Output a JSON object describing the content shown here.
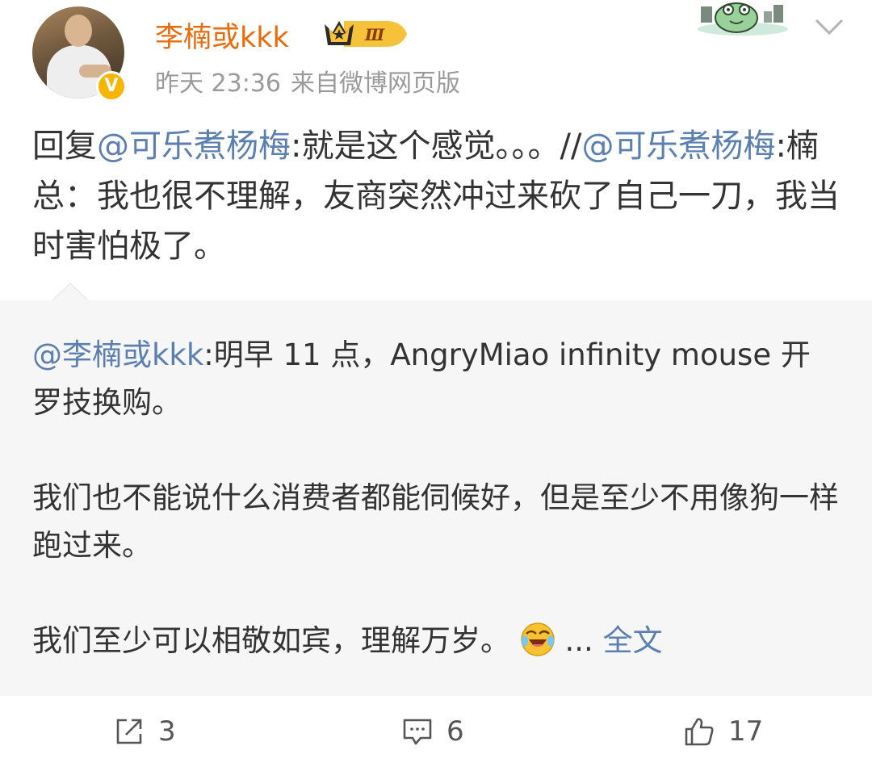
{
  "header": {
    "username": "李楠或kkk",
    "vip_level": "Ⅲ",
    "verified_mark": "V",
    "time": "昨天 23:36",
    "source": "来自微博网页版"
  },
  "post": {
    "prefix": "回复",
    "mention": "@可乐煮杨梅",
    "text": ":就是这个感觉。。。//",
    "quoted_mention": "@可乐煮杨梅",
    "quoted_text": ":楠总：我也很不理解，友商突然冲过来砍了自己一刀，我当时害怕极了。"
  },
  "repost": {
    "mention": "@李楠或kkk",
    "paragraph1": ":明早 11 点，AngryMiao infinity mouse 开罗技换购。",
    "paragraph2": "我们也不能说什么消费者都能伺候好，但是至少不用像狗一样跑过来。",
    "paragraph3": "我们至少可以相敬如宾，理解万岁。",
    "ellipsis": " ... ",
    "full_text_link": "全文"
  },
  "actions": {
    "share_count": "3",
    "comment_count": "6",
    "like_count": "17"
  },
  "icons": [
    "share-icon",
    "comment-icon",
    "like-icon",
    "laugh-cry-emoji-icon",
    "chevron-down-icon",
    "crown-vip-icon",
    "frog-card-decoration"
  ],
  "colors": {
    "username": "#e86b0c",
    "link": "#5b80b0",
    "meta": "#9a9a9a",
    "repost_bg": "#f6f6f6",
    "verified": "#f7b500"
  }
}
